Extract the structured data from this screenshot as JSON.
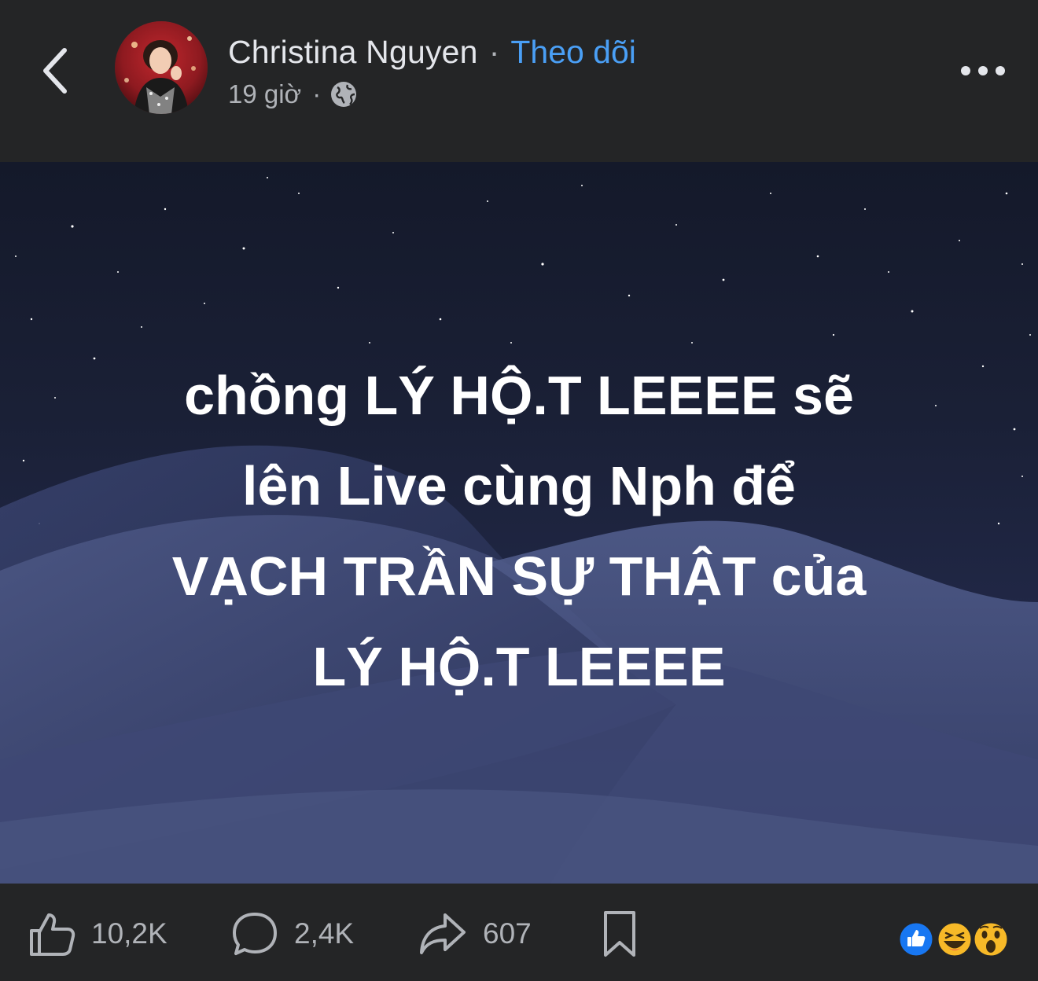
{
  "header": {
    "author_name": "Christina Nguyen",
    "separator": "·",
    "follow_label": "Theo dõi",
    "time_ago": "19 giờ",
    "meta_separator": "·",
    "back_icon": "chevron-left-icon",
    "privacy_icon": "globe-icon",
    "more_icon": "more-horizontal-icon"
  },
  "post": {
    "lines": [
      "chồng LÝ HỘ.T LEEEE sẽ",
      "lên Live cùng Nph để",
      "VẠCH TRẦN SỰ THẬT của",
      "LÝ HỘ.T LEEEE"
    ],
    "background": "night-sky-dunes"
  },
  "actions": {
    "like_count": "10,2K",
    "comment_count": "2,4K",
    "share_count": "607",
    "save_icon": "bookmark-icon"
  },
  "reactions": [
    "like",
    "haha",
    "wow"
  ],
  "colors": {
    "background": "#242526",
    "follow": "#4a9ff5",
    "muted": "#b0b3b8",
    "like_blue": "#1877f2",
    "emoji_yellow": "#f7b928"
  }
}
